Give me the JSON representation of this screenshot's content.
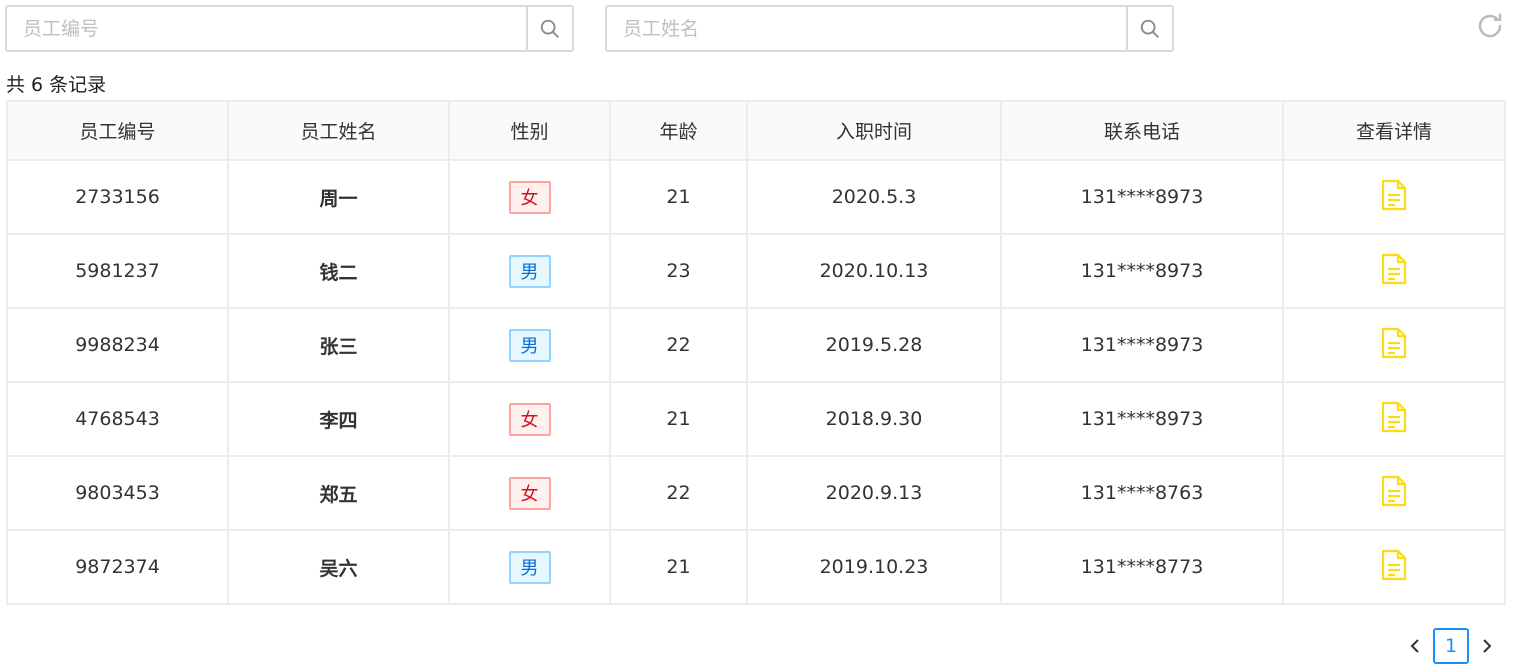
{
  "search": {
    "id_placeholder": "员工编号",
    "name_placeholder": "员工姓名",
    "icon": "search-icon"
  },
  "toolbar": {
    "refresh_icon": "refresh-icon"
  },
  "record_count": "共 6 条记录",
  "table": {
    "columns": [
      "员工编号",
      "员工姓名",
      "性别",
      "年龄",
      "入职时间",
      "联系电话",
      "查看详情"
    ],
    "rows": [
      {
        "id": "2733156",
        "name": "周一",
        "gender": "女",
        "age": "21",
        "hire_date": "2020.5.3",
        "phone": "131****8973"
      },
      {
        "id": "5981237",
        "name": "钱二",
        "gender": "男",
        "age": "23",
        "hire_date": "2020.10.13",
        "phone": "131****8973"
      },
      {
        "id": "9988234",
        "name": "张三",
        "gender": "男",
        "age": "22",
        "hire_date": "2019.5.28",
        "phone": "131****8973"
      },
      {
        "id": "4768543",
        "name": "李四",
        "gender": "女",
        "age": "21",
        "hire_date": "2018.9.30",
        "phone": "131****8973"
      },
      {
        "id": "9803453",
        "name": "郑五",
        "gender": "女",
        "age": "22",
        "hire_date": "2020.9.13",
        "phone": "131****8763"
      },
      {
        "id": "9872374",
        "name": "吴六",
        "gender": "男",
        "age": "21",
        "hire_date": "2019.10.23",
        "phone": "131****8773"
      }
    ],
    "detail_icon": "file-text-icon"
  },
  "pagination": {
    "current_page": "1"
  },
  "colors": {
    "female_tag": "#cf1322",
    "male_tag": "#096dd9",
    "detail_icon": "#fadb14",
    "page_active": "#1890ff"
  }
}
